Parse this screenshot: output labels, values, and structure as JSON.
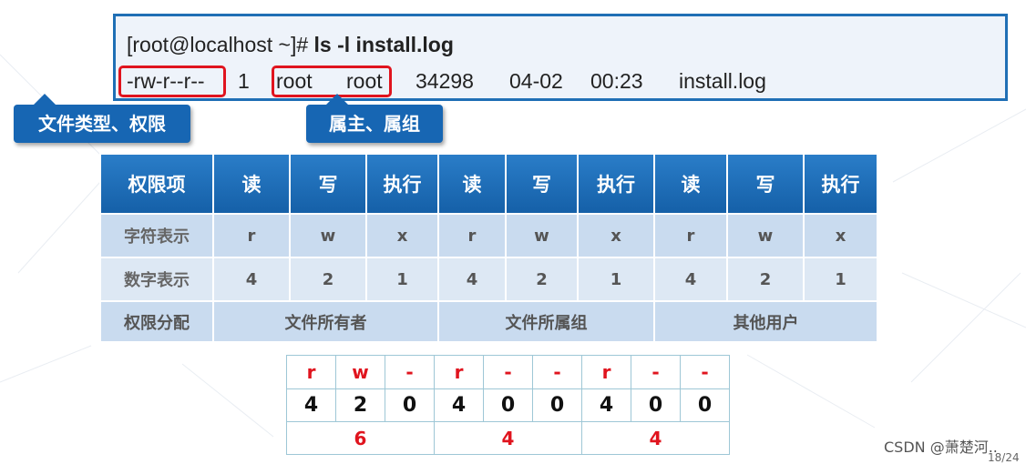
{
  "terminal": {
    "prompt": "[root@localhost ~]# ",
    "command": "ls -l install.log",
    "output": {
      "perms": "-rw-r--r--",
      "links": "1",
      "owner": "root",
      "group": "root",
      "size": "34298",
      "date": "04-02",
      "time": "00:23",
      "filename": "install.log"
    }
  },
  "callouts": {
    "type_perm": "文件类型、权限",
    "owner_group": "属主、属组"
  },
  "perm_table": {
    "header": [
      "权限项",
      "读",
      "写",
      "执行",
      "读",
      "写",
      "执行",
      "读",
      "写",
      "执行"
    ],
    "char_row": [
      "字符表示",
      "r",
      "w",
      "x",
      "r",
      "w",
      "x",
      "r",
      "w",
      "x"
    ],
    "num_row": [
      "数字表示",
      "4",
      "2",
      "1",
      "4",
      "2",
      "1",
      "4",
      "2",
      "1"
    ],
    "assign_row": [
      "权限分配",
      "文件所有者",
      "文件所属组",
      "其他用户"
    ]
  },
  "example": {
    "symbols": [
      "r",
      "w",
      "-",
      "r",
      "-",
      "-",
      "r",
      "-",
      "-"
    ],
    "digits": [
      "4",
      "2",
      "0",
      "4",
      "0",
      "0",
      "4",
      "0",
      "0"
    ],
    "sums": [
      "6",
      "4",
      "4"
    ]
  },
  "watermark": "CSDN @萧楚河..",
  "page": "18/24",
  "colors": {
    "accent_blue": "#1766b3",
    "highlight_red": "#e0141e",
    "table_light": "#c9dbef"
  }
}
